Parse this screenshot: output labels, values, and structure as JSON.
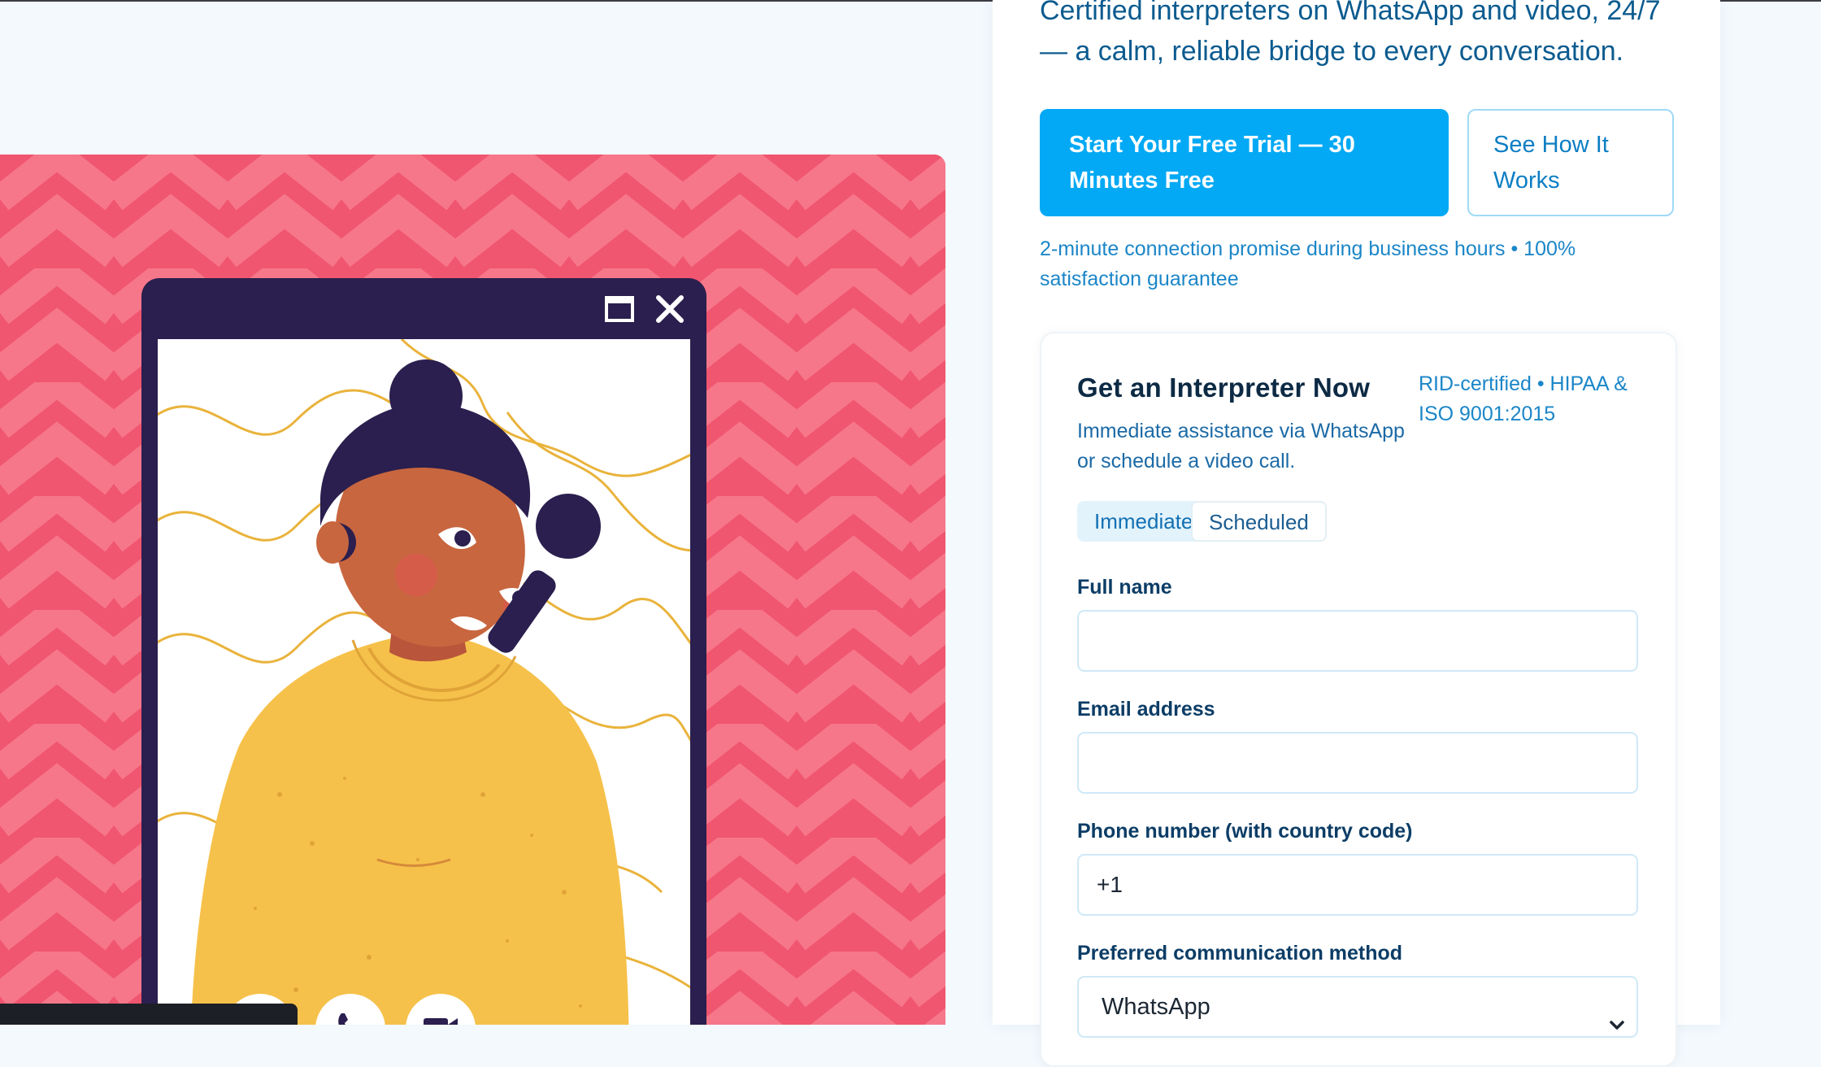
{
  "hero": {
    "subtitle": "Certified interpreters on WhatsApp and video, 24/7 — a calm, reliable bridge to every conversation.",
    "cta_primary": "Start Your Free Trial — 30 Minutes Free",
    "cta_secondary": "See How It Works",
    "promise": "2-minute connection promise during business hours • 100% satisfaction guarantee"
  },
  "illustration": {
    "icons": [
      "maximize-window-icon",
      "close-window-icon",
      "mic-off-icon",
      "phone-icon",
      "video-camera-icon"
    ]
  },
  "form": {
    "title": "Get an Interpreter Now",
    "description": "Immediate assistance via WhatsApp or schedule a video call.",
    "certifications": "RID-certified • HIPAA & ISO 9001:2015",
    "tabs": [
      {
        "label": "Immediate",
        "active": true
      },
      {
        "label": "Scheduled",
        "active": false
      }
    ],
    "full_name_label": "Full name",
    "full_name_value": "",
    "email_label": "Email address",
    "email_value": "",
    "phone_label": "Phone number (with country code)",
    "phone_value": "+1",
    "method_label": "Preferred communication method",
    "method_selected": "WhatsApp"
  },
  "colors": {
    "primary": "#03a9f4",
    "hero_background": "#f0566f",
    "device_frame": "#2a1f4e",
    "sweater": "#f6c14a"
  }
}
